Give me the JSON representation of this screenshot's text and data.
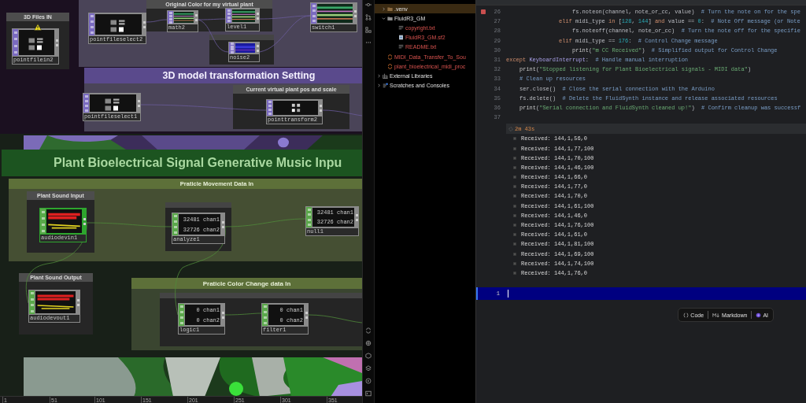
{
  "network": {
    "boxes": [
      {
        "title": "3D Files IN"
      },
      {
        "title": "Original Color for my virtual plant"
      },
      {
        "title": "Current virtual plant pos and scale"
      },
      {
        "title": "Plant Sound Input"
      },
      {
        "title": "Plant Sound Output"
      }
    ],
    "transform_banner": "3D model transformation Setting",
    "music_banner": "Plant Bioelectrical Signal Generative Music Inpu",
    "movement_panel": "Praticle Movement Data In",
    "color_panel": "Praticle Color Change data In",
    "nodes": [
      {
        "name": "pointfilein2",
        "kind": "pointfile",
        "warning": true,
        "highlighted": false
      },
      {
        "name": "pointfileselect2",
        "kind": "pointfile",
        "warning": false,
        "highlighted": false
      },
      {
        "name": "math2",
        "kind": "top",
        "warning": false,
        "highlighted": false
      },
      {
        "name": "level1",
        "kind": "top",
        "warning": false,
        "highlighted": false
      },
      {
        "name": "switch1",
        "kind": "top",
        "warning": false,
        "highlighted": false
      },
      {
        "name": "noise2",
        "kind": "noise",
        "warning": false,
        "highlighted": false
      },
      {
        "name": "pointfileselect1",
        "kind": "pointfile",
        "warning": false,
        "highlighted": false
      },
      {
        "name": "pointtransform2",
        "kind": "transform",
        "warning": false,
        "highlighted": false
      },
      {
        "name": "audiodevin1",
        "kind": "audio",
        "warning": false,
        "highlighted": true
      },
      {
        "name": "analyze1",
        "kind": "chop",
        "warning": false,
        "highlighted": false,
        "lines": [
          "32481 chan1",
          "32726 chan2"
        ]
      },
      {
        "name": "null1",
        "kind": "chop",
        "warning": false,
        "highlighted": false,
        "lines": [
          "32481 chan1",
          "32726 chan2"
        ]
      },
      {
        "name": "audiodevout1",
        "kind": "audio",
        "warning": false,
        "highlighted": false
      },
      {
        "name": "logic1",
        "kind": "chop",
        "warning": false,
        "highlighted": false,
        "lines": [
          "0 chan1",
          "0 chan2"
        ]
      },
      {
        "name": "filter1",
        "kind": "chop",
        "warning": false,
        "highlighted": false,
        "lines": [
          "0 chan1",
          "0 chan2"
        ]
      }
    ],
    "timeline_ticks": [
      "1",
      "51",
      "101",
      "151",
      "201",
      "251",
      "301",
      "351"
    ]
  },
  "project_files": [
    {
      "label": ".venv",
      "kind": "folder",
      "selected": true,
      "expanded": false,
      "untracked": false
    },
    {
      "label": "FluidR3_GM",
      "kind": "folder",
      "selected": false,
      "expanded": true,
      "untracked": false,
      "children": [
        {
          "label": "copyright.txt",
          "kind": "text",
          "selected": false,
          "untracked": true
        },
        {
          "label": "FluidR3_GM.sf2",
          "kind": "soundfont",
          "selected": false,
          "untracked": true
        },
        {
          "label": "README.txt",
          "kind": "text",
          "selected": false,
          "untracked": true
        }
      ]
    },
    {
      "label": "MIDI_Data_Transfer_To_Sou",
      "kind": "python",
      "selected": false,
      "untracked": true
    },
    {
      "label": "plant_bioelectrical_midi_proc",
      "kind": "python",
      "selected": false,
      "untracked": true
    }
  ],
  "tree_roots": [
    {
      "label": "External Libraries",
      "kind": "library",
      "selected": false,
      "expanded": false
    },
    {
      "label": "Scratches and Consoles",
      "kind": "scratch",
      "selected": false,
      "expanded": false
    }
  ],
  "code_lines": [
    {
      "number": "26",
      "breakpoint": true,
      "kind": "action",
      "tokens": [
        {
          "kind": "plain",
          "text": "fs.noteon(channel, note_or_cc, value)  "
        },
        {
          "kind": "comment",
          "text": "# Turn the note on for the spe"
        }
      ]
    },
    {
      "number": "27",
      "breakpoint": false,
      "kind": "branch",
      "tokens": [
        {
          "kind": "keyword",
          "text": "elif"
        },
        {
          "kind": "plain",
          "text": " midi_type "
        },
        {
          "kind": "keyword",
          "text": "in"
        },
        {
          "kind": "plain",
          "text": " ["
        },
        {
          "kind": "number",
          "text": "128"
        },
        {
          "kind": "plain",
          "text": ", "
        },
        {
          "kind": "number",
          "text": "144"
        },
        {
          "kind": "plain",
          "text": "] "
        },
        {
          "kind": "keyword",
          "text": "and"
        },
        {
          "kind": "plain",
          "text": " value == "
        },
        {
          "kind": "number",
          "text": "0"
        },
        {
          "kind": "plain",
          "text": ":  "
        },
        {
          "kind": "comment",
          "text": "# Note Off message (or Note"
        }
      ]
    },
    {
      "number": "28",
      "breakpoint": false,
      "kind": "action",
      "tokens": [
        {
          "kind": "plain",
          "text": "fs.noteoff(channel, note_or_cc)  "
        },
        {
          "kind": "comment",
          "text": "# Turn the note off for the specifie"
        }
      ]
    },
    {
      "number": "29",
      "breakpoint": false,
      "kind": "branch",
      "tokens": [
        {
          "kind": "keyword",
          "text": "elif"
        },
        {
          "kind": "plain",
          "text": " midi_type == "
        },
        {
          "kind": "number",
          "text": "176"
        },
        {
          "kind": "plain",
          "text": ":  "
        },
        {
          "kind": "comment",
          "text": "# Control Change message"
        }
      ]
    },
    {
      "number": "30",
      "breakpoint": false,
      "kind": "action",
      "tokens": [
        {
          "kind": "builtin",
          "text": "print"
        },
        {
          "kind": "plain",
          "text": "("
        },
        {
          "kind": "string",
          "text": "\"⊞ CC Received\""
        },
        {
          "kind": "plain",
          "text": ")  "
        },
        {
          "kind": "comment",
          "text": "# Simplified output for Control Change"
        }
      ]
    },
    {
      "number": "31",
      "breakpoint": false,
      "kind": "top",
      "tokens": [
        {
          "kind": "keyword",
          "text": "except"
        },
        {
          "kind": "class",
          "text": " KeyboardInterrupt"
        },
        {
          "kind": "plain",
          "text": ":  "
        },
        {
          "kind": "comment",
          "text": "# Handle manual interruption"
        }
      ]
    },
    {
      "number": "32",
      "breakpoint": false,
      "kind": "handler",
      "tokens": [
        {
          "kind": "builtin",
          "text": "print"
        },
        {
          "kind": "plain",
          "text": "("
        },
        {
          "kind": "string",
          "text": "\"Stopped listening for Plant Bioelectrical signals - MIDI data\""
        },
        {
          "kind": "plain",
          "text": ")"
        }
      ]
    },
    {
      "number": "33",
      "breakpoint": false,
      "kind": "handler",
      "tokens": [
        {
          "kind": "comment",
          "text": "# Clean up resources"
        }
      ]
    },
    {
      "number": "34",
      "breakpoint": false,
      "kind": "handler",
      "tokens": [
        {
          "kind": "plain",
          "text": "ser.close()  "
        },
        {
          "kind": "comment",
          "text": "# Close the serial connection with the Arduino"
        }
      ]
    },
    {
      "number": "35",
      "breakpoint": false,
      "kind": "handler",
      "tokens": [
        {
          "kind": "plain",
          "text": "fs.delete()  "
        },
        {
          "kind": "comment",
          "text": "# Delete the FluidSynth instance and release associated resources"
        }
      ]
    },
    {
      "number": "36",
      "breakpoint": false,
      "kind": "handler",
      "tokens": [
        {
          "kind": "builtin",
          "text": "print"
        },
        {
          "kind": "plain",
          "text": "("
        },
        {
          "kind": "string",
          "text": "\"Serial connection and FluidSynth cleaned up!\""
        },
        {
          "kind": "plain",
          "text": ")  "
        },
        {
          "kind": "comment",
          "text": "# Confirm cleanup was successf"
        }
      ]
    },
    {
      "number": "37",
      "breakpoint": false
    }
  ],
  "console": {
    "elapsed": "2m 43s",
    "rows": [
      "Received: 144,1,56,0",
      "Received: 144,1,77,100",
      "Received: 144,1,70,100",
      "Received: 144,1,46,100",
      "Received: 144,1,66,0",
      "Received: 144,1,77,0",
      "Received: 144,1,70,0",
      "Received: 144,1,61,100",
      "Received: 144,1,46,0",
      "Received: 144,1,76,100",
      "Received: 144,1,61,0",
      "Received: 144,1,81,100",
      "Received: 144,1,69,100",
      "Received: 144,1,74,100",
      "Received: 144,1,76,0"
    ]
  },
  "new_cell": {
    "number": "1"
  },
  "cell_toolbar": [
    {
      "label": "Code",
      "kind": "code"
    },
    {
      "label": "Markdown",
      "kind": "markdown"
    },
    {
      "label": "AI",
      "kind": "ai"
    }
  ]
}
